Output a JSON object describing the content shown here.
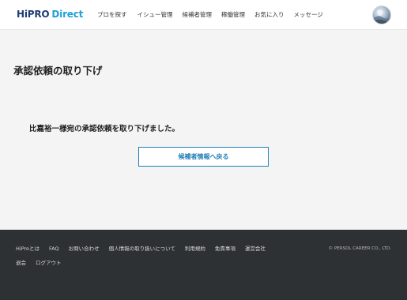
{
  "header": {
    "logo": {
      "hi": "Hi",
      "pro": "PRO",
      "direct": "Direct"
    },
    "nav": [
      {
        "label": "プロを探す"
      },
      {
        "label": "イシュー管理"
      },
      {
        "label": "候補者管理"
      },
      {
        "label": "稼働管理"
      },
      {
        "label": "お気に入り"
      },
      {
        "label": "メッセージ"
      }
    ]
  },
  "main": {
    "title": "承認依頼の取り下げ",
    "message": "比嘉裕一様宛の承認依頼を取り下げました。",
    "back_button": "候補者情報へ戻る"
  },
  "footer": {
    "links_row1": [
      {
        "label": "HiProとは"
      },
      {
        "label": "FAQ"
      },
      {
        "label": "お問い合わせ"
      },
      {
        "label": "個人情報の取り扱いについて"
      },
      {
        "label": "利用規約"
      },
      {
        "label": "免責事項"
      },
      {
        "label": "運営会社"
      }
    ],
    "links_row2": [
      {
        "label": "退会"
      },
      {
        "label": "ログアウト"
      }
    ],
    "copyright": "© PERSOL CAREER CO., LTD."
  },
  "colors": {
    "accent": "#1f7fb6",
    "logo_dark": "#1f3b73",
    "logo_light": "#1fa0d8",
    "footer_bg": "#2e3133",
    "page_bg": "#f4f4f4"
  }
}
